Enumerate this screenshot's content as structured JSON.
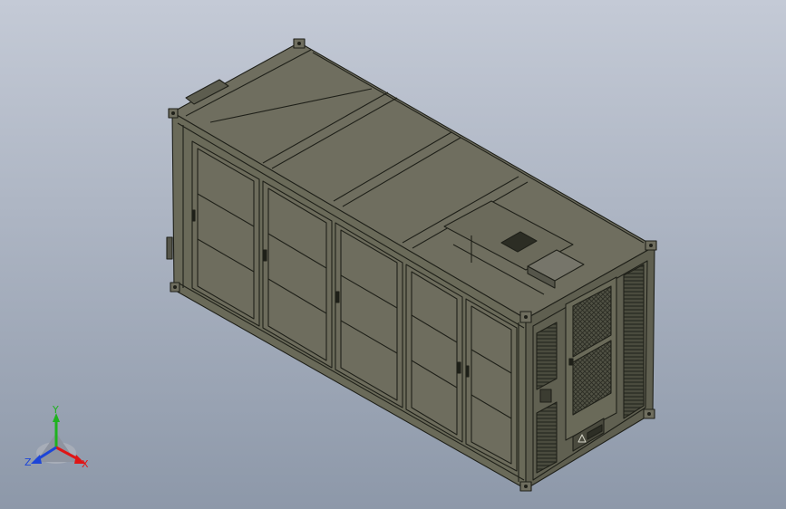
{
  "viewport": {
    "background_top": "#c4cad6",
    "background_bottom": "#8d98a9"
  },
  "model": {
    "body_color": "#6d6c5c",
    "top_color": "#6f6e5f",
    "side_color": "#6a6a59",
    "end_color": "#5f5f50",
    "edge_color": "#1f2019",
    "door_count_side": 5,
    "louver_color": "#3d3e33"
  },
  "triad": {
    "x_label": "X",
    "y_label": "Y",
    "z_label": "Z",
    "x_color": "#e01515",
    "y_color": "#1fb21f",
    "z_color": "#1d45d8"
  }
}
